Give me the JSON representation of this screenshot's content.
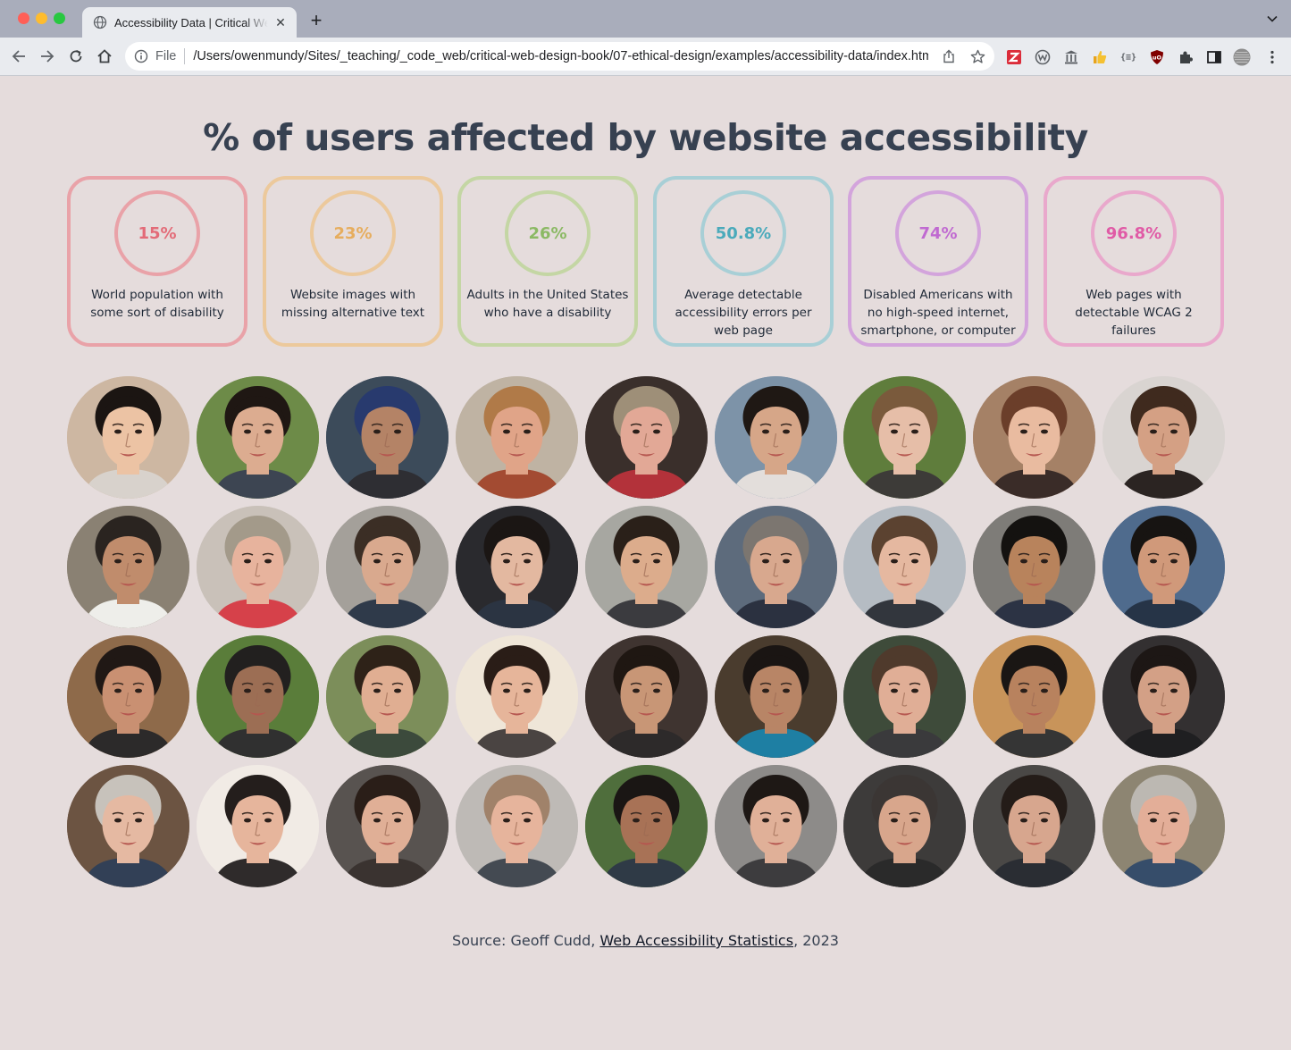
{
  "browser": {
    "tab_title": "Accessibility Data | Critical Web Design",
    "url_scheme": "File",
    "url": "/Users/owenmundy/Sites/_teaching/_code_web/critical-web-design-book/07-ethical-design/examples/accessibility-data/index.html"
  },
  "page": {
    "title": "% of users affected by website accessibility"
  },
  "stats": [
    {
      "value": "15%",
      "label": "World population with some sort of disability",
      "color": "#e9a2a8",
      "text_color": "#e36b78"
    },
    {
      "value": "23%",
      "label": "Website images with missing alternative text",
      "color": "#ecc99c",
      "text_color": "#e6ad5e"
    },
    {
      "value": "26%",
      "label": "Adults in the United States who have a disability",
      "color": "#c4d6a4",
      "text_color": "#8bb964"
    },
    {
      "value": "50.8%",
      "label": "Average detectable accessibility errors per web page",
      "color": "#a8cfd6",
      "text_color": "#4aaabb"
    },
    {
      "value": "74%",
      "label": "Disabled Americans with no high-speed internet, smartphone, or computer",
      "color": "#d3a4dc",
      "text_color": "#c06ad1"
    },
    {
      "value": "96.8%",
      "label": "Web pages with detectable WCAG 2 failures",
      "color": "#e9a8cc",
      "text_color": "#e05ba6"
    }
  ],
  "faces": [
    {
      "bg": "#cdb7a2",
      "skin": "#ecc3a4",
      "hair": "#1b1512",
      "shirt": "#d8d2cc"
    },
    {
      "bg": "#6d8b48",
      "skin": "#dcac90",
      "hair": "#1f1713",
      "shirt": "#3d4552"
    },
    {
      "bg": "#3c4b5a",
      "skin": "#b48366",
      "hair": "#283a6e",
      "shirt": "#2e2e33"
    },
    {
      "bg": "#bfb3a3",
      "skin": "#e0a488",
      "hair": "#b07a48",
      "shirt": "#a34b32"
    },
    {
      "bg": "#3a2f2b",
      "skin": "#e2a896",
      "hair": "#9e8f78",
      "shirt": "#b3323a"
    },
    {
      "bg": "#7d93a8",
      "skin": "#d6a688",
      "hair": "#1f1814",
      "shirt": "#e3dedb"
    },
    {
      "bg": "#5f7d3c",
      "skin": "#e6bea8",
      "hair": "#7a5a3c",
      "shirt": "#3d3b38"
    },
    {
      "bg": "#a58166",
      "skin": "#e9bba0",
      "hair": "#6b3e2a",
      "shirt": "#3a2c28"
    },
    {
      "bg": "#d9d4d1",
      "skin": "#d4a084",
      "hair": "#3f2a1e",
      "shirt": "#2b2422"
    },
    {
      "bg": "#8a8173",
      "skin": "#c08c6c",
      "hair": "#2a2420",
      "shirt": "#eeeeea"
    },
    {
      "bg": "#c9c1b9",
      "skin": "#e7b39d",
      "hair": "#a39a8a",
      "shirt": "#d6414a"
    },
    {
      "bg": "#a4a09a",
      "skin": "#d9a98e",
      "hair": "#3b2e25",
      "shirt": "#2f3a4a"
    },
    {
      "bg": "#2a2a2e",
      "skin": "#e3b8a0",
      "hair": "#1b1614",
      "shirt": "#2b3442"
    },
    {
      "bg": "#a7a7a1",
      "skin": "#dcac8c",
      "hair": "#2a2019",
      "shirt": "#3b3b3f"
    },
    {
      "bg": "#5d6b7c",
      "skin": "#d8a88e",
      "hair": "#7c7670",
      "shirt": "#2b3140"
    },
    {
      "bg": "#b5bcc3",
      "skin": "#e5b8a0",
      "hair": "#5b4230",
      "shirt": "#32363d"
    },
    {
      "bg": "#7e7c78",
      "skin": "#b8835c",
      "hair": "#141210",
      "shirt": "#2c3344"
    },
    {
      "bg": "#4f6b8d",
      "skin": "#d0997a",
      "hair": "#171412",
      "shirt": "#263447"
    },
    {
      "bg": "#8e6a4a",
      "skin": "#c99072",
      "hair": "#201815",
      "shirt": "#2c2a2a"
    },
    {
      "bg": "#5a7d3a",
      "skin": "#9c6e54",
      "hair": "#22201f",
      "shirt": "#303030"
    },
    {
      "bg": "#7c8e5a",
      "skin": "#e0ae92",
      "hair": "#2e2218",
      "shirt": "#3c4a3c"
    },
    {
      "bg": "#efe6d8",
      "skin": "#e6b59a",
      "hair": "#2a1d17",
      "shirt": "#4a4442"
    },
    {
      "bg": "#3f3430",
      "skin": "#c89676",
      "hair": "#1f1712",
      "shirt": "#2d2a2a"
    },
    {
      "bg": "#4a3c2e",
      "skin": "#b88566",
      "hair": "#1a1513",
      "shirt": "#1e7fa3"
    },
    {
      "bg": "#3e4b3a",
      "skin": "#e0ae96",
      "hair": "#4f3a2c",
      "shirt": "#3a3a3c"
    },
    {
      "bg": "#c8945a",
      "skin": "#b8825e",
      "hair": "#1a1614",
      "shirt": "#353535"
    },
    {
      "bg": "#333031",
      "skin": "#d3a086",
      "hair": "#1d1715",
      "shirt": "#1f1f21"
    },
    {
      "bg": "#6c5442",
      "skin": "#e5b9a2",
      "hair": "#c7c2bb",
      "shirt": "#324056"
    },
    {
      "bg": "#f1ebe5",
      "skin": "#e6b59c",
      "hair": "#241e1c",
      "shirt": "#2f2b2b"
    },
    {
      "bg": "#585350",
      "skin": "#e0af96",
      "hair": "#2a1e18",
      "shirt": "#3a3330"
    },
    {
      "bg": "#bebab6",
      "skin": "#e6b49c",
      "hair": "#a0826a",
      "shirt": "#444a52"
    },
    {
      "bg": "#4f6e3c",
      "skin": "#a87256",
      "hair": "#1a1614",
      "shirt": "#2f3a46"
    },
    {
      "bg": "#8d8b89",
      "skin": "#e0b098",
      "hair": "#1e1815",
      "shirt": "#3d3c3e"
    },
    {
      "bg": "#3d3b3a",
      "skin": "#d8a68c",
      "hair": "#3b3634",
      "shirt": "#2a2a2a"
    },
    {
      "bg": "#4a4846",
      "skin": "#d7a68e",
      "hair": "#241c18",
      "shirt": "#2a2d33"
    },
    {
      "bg": "#8d8572",
      "skin": "#e3ae98",
      "hair": "#bcb8b2",
      "shirt": "#364d6a"
    }
  ],
  "source": {
    "prefix": "Source: Geoff Cudd, ",
    "link_text": "Web Accessibility Statistics",
    "suffix": ", 2023"
  }
}
